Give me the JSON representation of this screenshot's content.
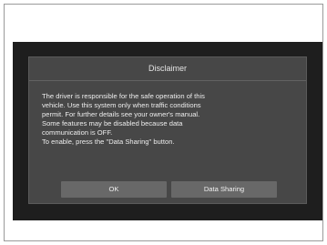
{
  "dialog": {
    "title": "Disclaimer",
    "body_lines": [
      "The driver is responsible for the safe operation of this",
      "vehicle. Use this system only when traffic conditions",
      "permit. For further details see your owner's manual.",
      "Some features may be disabled because data",
      "communication is OFF.",
      "To enable, press the \"Data Sharing\" button."
    ],
    "ok_label": "OK",
    "data_sharing_label": "Data Sharing"
  },
  "colors": {
    "screen_background": "#1e1e1e",
    "dialog_background": "#474747",
    "button_background": "#686868",
    "text": "#ededed"
  }
}
